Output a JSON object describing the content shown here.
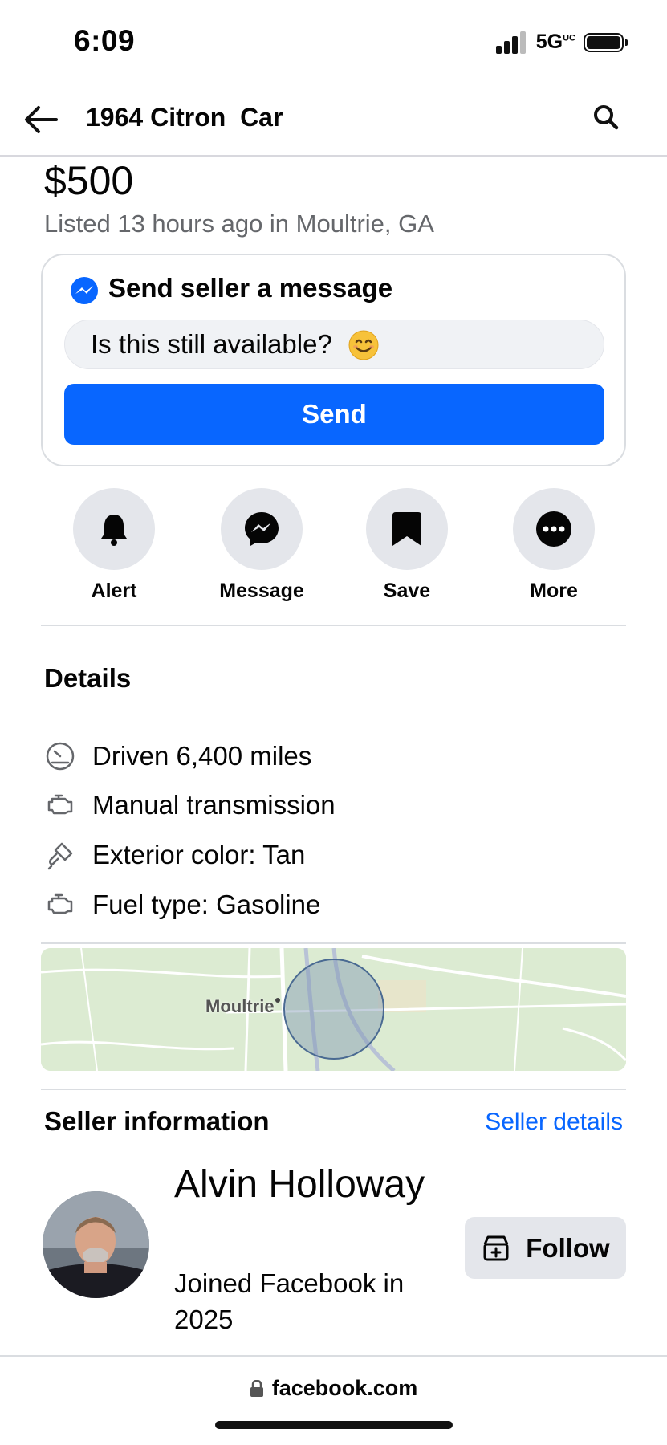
{
  "status_bar": {
    "time": "6:09",
    "network": "5G",
    "network_sup": "UC"
  },
  "header": {
    "title": "1964 Citron  Car"
  },
  "listing": {
    "price": "$500",
    "listed": "Listed 13 hours ago in Moultrie, GA"
  },
  "message_card": {
    "title": "Send seller a message",
    "input_value": "Is this still available?",
    "send_label": "Send"
  },
  "actions": [
    {
      "label": "Alert",
      "icon": "bell-icon"
    },
    {
      "label": "Message",
      "icon": "messenger-icon"
    },
    {
      "label": "Save",
      "icon": "bookmark-icon"
    },
    {
      "label": "More",
      "icon": "more-icon"
    }
  ],
  "details": {
    "title": "Details",
    "items": [
      {
        "text": "Driven 6,400 miles",
        "icon": "speedometer-icon"
      },
      {
        "text": "Manual transmission",
        "icon": "engine-icon"
      },
      {
        "text": "Exterior color: Tan",
        "icon": "paintbrush-icon"
      },
      {
        "text": "Fuel type: Gasoline",
        "icon": "engine-icon"
      }
    ]
  },
  "map": {
    "label": "Moultrie"
  },
  "seller": {
    "title": "Seller information",
    "details_link": "Seller details",
    "name": "Alvin Holloway",
    "joined": "Joined Facebook in 2025",
    "follow_label": "Follow"
  },
  "browser": {
    "url": "facebook.com"
  },
  "colors": {
    "accent": "#0866ff",
    "button_gray": "#e4e6eb",
    "text_secondary": "#65676b"
  }
}
